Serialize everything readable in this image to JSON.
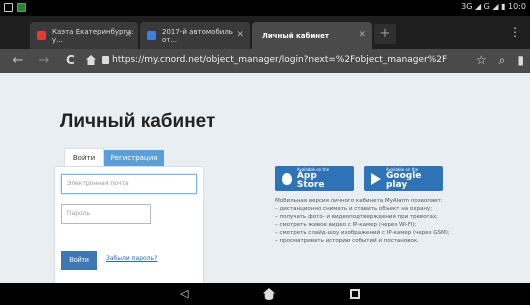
{
  "status_bar": {
    "right_text": "3G ◢ G ◢ ▮ 10:0"
  },
  "browser": {
    "tabs": [
      {
        "title": "Каэта Екатеринбурга: у...",
        "icon_color": "#e53935",
        "active": false
      },
      {
        "title": "2017-й автомобиль от...",
        "icon_color": "#3f7fe0",
        "active": false
      },
      {
        "title": "Личный кабинет",
        "icon_color": "",
        "active": true
      }
    ],
    "new_tab_label": "+",
    "menu_icon": "⋮",
    "url": "https://my.cnord.net/object_manager/login?next=%2Fobject_manager%2F"
  },
  "page": {
    "title": "Личный кабинет",
    "tabs": {
      "login": "Войти",
      "register": "Регистрация"
    },
    "form": {
      "email_placeholder": "Электронная почта",
      "password_placeholder": "Пароль",
      "submit_label": "Войти",
      "forgot_link": "Забыли пароль?"
    },
    "stores": {
      "apple_small": "Available on the",
      "apple_big": "App Store",
      "google_small": "Available on the",
      "google_big": "Google play"
    },
    "description": {
      "intro": "Мобильная версия личного кабинета MyAlarm позволяет:",
      "items": [
        "дистанционно снимать и ставить объект на охрану;",
        "получать фото- и видеоподтверждения при тревогах;",
        "смотреть живое видео с IP-камер (через Wi-Fi);",
        "смотреть слайд-шоу изображений с IP-камер (через GSM);",
        "просматривать историю событий и постановок."
      ]
    }
  },
  "colors": {
    "accent": "#3f76b4",
    "store_button": "#2f73b7",
    "page_bg": "#e9eef3"
  }
}
